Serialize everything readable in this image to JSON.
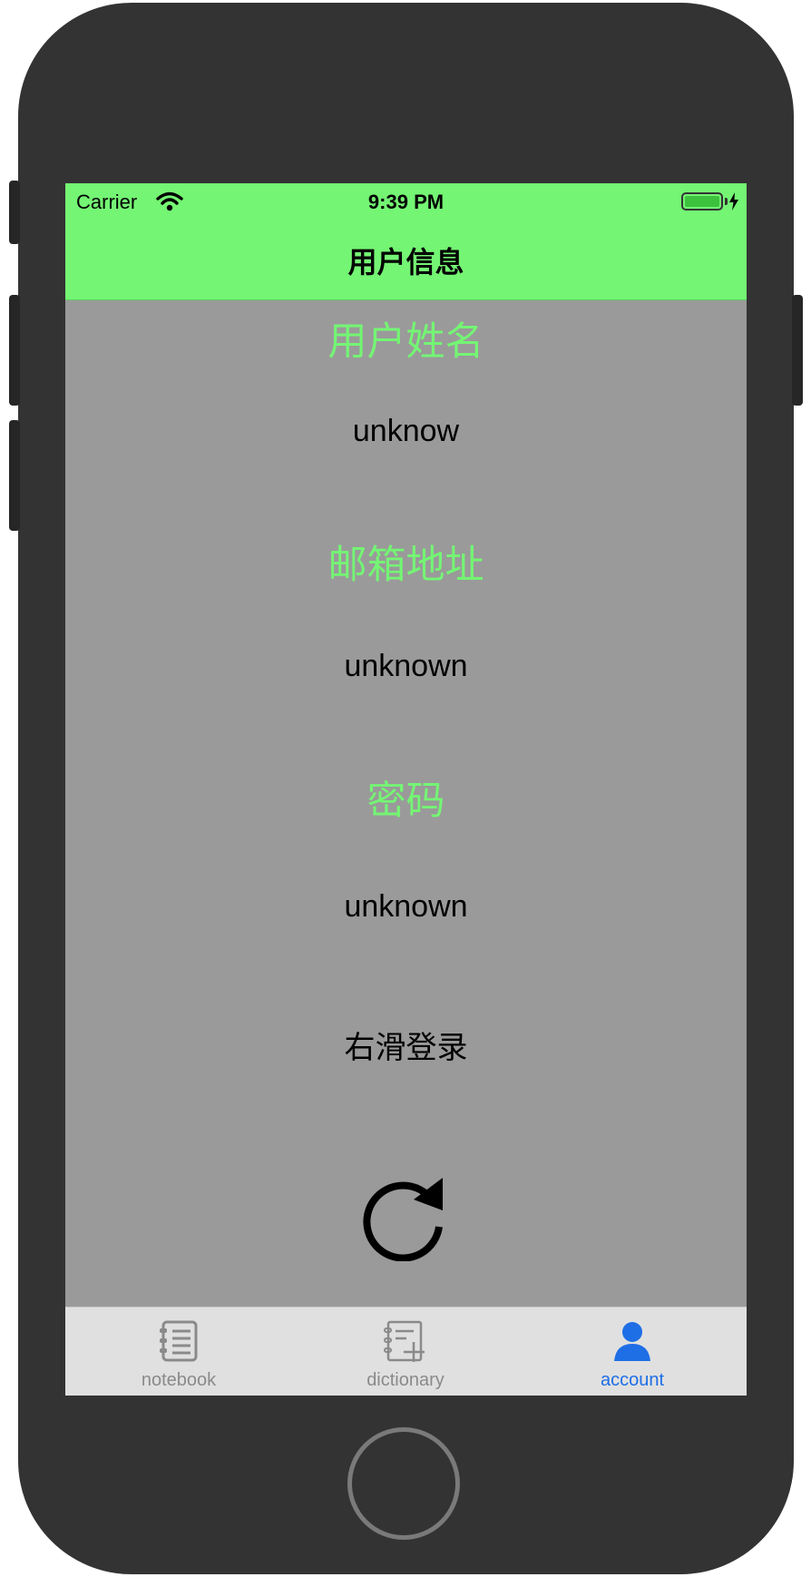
{
  "status_bar": {
    "carrier": "Carrier",
    "time": "9:39 PM"
  },
  "nav": {
    "title": "用户信息"
  },
  "fields": [
    {
      "label": "用户姓名",
      "value": "unknow"
    },
    {
      "label": "邮箱地址",
      "value": "unknown"
    },
    {
      "label": "密码",
      "value": "unknown"
    }
  ],
  "swipe_hint": "右滑登录",
  "tabs": [
    {
      "label": "notebook",
      "icon": "notebook-icon",
      "active": false
    },
    {
      "label": "dictionary",
      "icon": "dictionary-icon",
      "active": false
    },
    {
      "label": "account",
      "icon": "account-icon",
      "active": true
    }
  ],
  "colors": {
    "nav_background": "#74f574",
    "content_background": "#9a9a9a",
    "label_green": "#74f574",
    "tab_active": "#1e6ee6",
    "tab_inactive": "#8a8a8a"
  }
}
